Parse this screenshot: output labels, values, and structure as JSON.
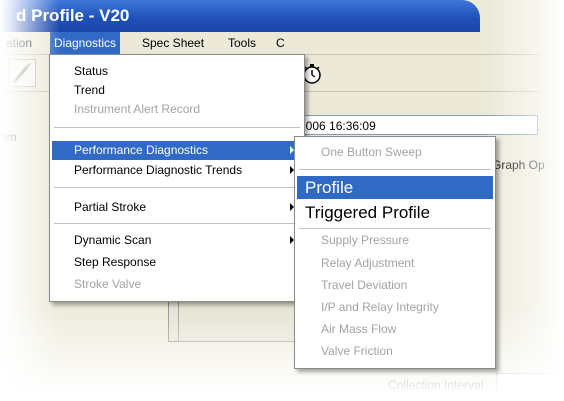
{
  "window": {
    "title": "d Profile - V20"
  },
  "menubar": {
    "items": [
      {
        "label": "ation"
      },
      {
        "label": "Diagnostics"
      },
      {
        "label": "Spec Sheet"
      },
      {
        "label": "Tools"
      },
      {
        "label": "C"
      }
    ]
  },
  "tree": {
    "label": "em"
  },
  "datetime": "ov 2006 16:36:09",
  "graph_options": "Graph Op",
  "collection": {
    "label": "Collection Interval"
  },
  "diagnostics_menu": {
    "items": [
      {
        "label": "Status"
      },
      {
        "label": "Trend"
      },
      {
        "label": "Instrument Alert Record"
      },
      {
        "label": "Performance Diagnostics"
      },
      {
        "label": "Performance Diagnostic Trends"
      },
      {
        "label": "Partial Stroke"
      },
      {
        "label": "Dynamic Scan"
      },
      {
        "label": "Step Response"
      },
      {
        "label": "Stroke Valve"
      }
    ]
  },
  "performance_submenu": {
    "items": [
      {
        "label": "One Button Sweep"
      },
      {
        "label": "Profile"
      },
      {
        "label": "Triggered Profile"
      },
      {
        "label": "Supply Pressure"
      },
      {
        "label": "Relay Adjustment"
      },
      {
        "label": "Travel Deviation"
      },
      {
        "label": "I/P and Relay Integrity"
      },
      {
        "label": "Air Mass Flow"
      },
      {
        "label": "Valve Friction"
      }
    ]
  },
  "icons": {
    "toolbar_left": "dropper-icon",
    "toolbar_right": "stopwatch-icon"
  },
  "colors": {
    "title_bar": "#1e4fb8",
    "menu_highlight": "#316ac5",
    "disabled_text": "#a3a3a3"
  }
}
